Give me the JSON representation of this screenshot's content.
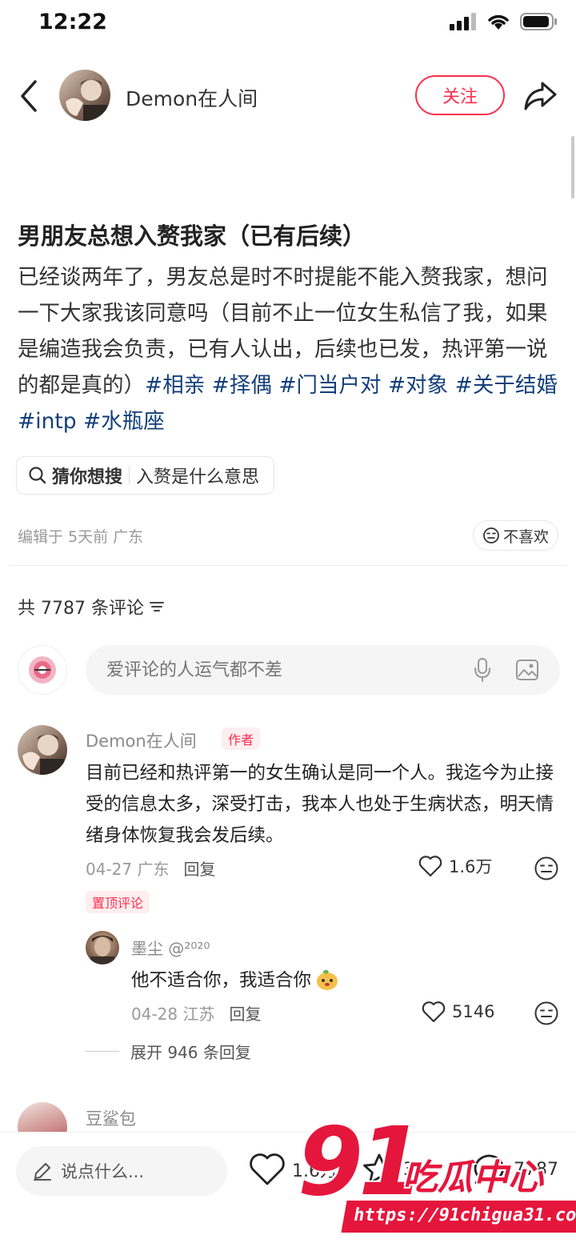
{
  "status_bar": {
    "time": "12:22"
  },
  "header": {
    "author_name": "Demon在人间",
    "follow_label": "关注"
  },
  "post": {
    "title": "男朋友总想入赘我家（已有后续）",
    "body": "已经谈两年了，男友总是时不时提能不能入赘我家，想问一下大家我该同意吗（目前不止一位女生私信了我，如果是编造我会负责，已有人认出，后续也已发，热评第一说的都是真的）",
    "tags": [
      "#相亲",
      "#择偶",
      "#门当户对",
      "#对象",
      "#关于结婚",
      "#intp",
      "#水瓶座"
    ],
    "search_chip": {
      "label": "猜你想搜",
      "query": "入赘是什么意思"
    },
    "edit_info": "编辑于 5天前 广东",
    "dislike_label": "不喜欢"
  },
  "comments_section": {
    "count_label": "共 7787 条评论",
    "input_placeholder": "爱评论的人运气都不差",
    "comments": [
      {
        "author": "Demon在人间",
        "badge": "作者",
        "text": "目前已经和热评第一的女生确认是同一个人。我迄今为止接受的信息太多，深受打击，我本人也处于生病状态，明天情绪身体恢复我会发后续。",
        "date_location": "04-27 广东",
        "reply_label": "回复",
        "likes": "1.6万",
        "pinned_label": "置顶评论",
        "replies": [
          {
            "author": "墨尘 @²⁰²⁰",
            "text": "他不适合你，我适合你",
            "date_location": "04-28 江苏",
            "reply_label": "回复",
            "likes": "5146"
          }
        ],
        "expand_label": "展开 946 条回复"
      },
      {
        "author": "豆鲨包"
      }
    ]
  },
  "bottom_bar": {
    "input_placeholder": "说点什么...",
    "likes": "1.6万",
    "stars": "3",
    "comments": "7787"
  },
  "watermark": {
    "number": "91",
    "text": "吃瓜中心",
    "url": "https://91chigua31.com"
  },
  "colors": {
    "accent": "#ff2e4d",
    "tag": "#133f7a",
    "watermark": "#e5163c"
  }
}
